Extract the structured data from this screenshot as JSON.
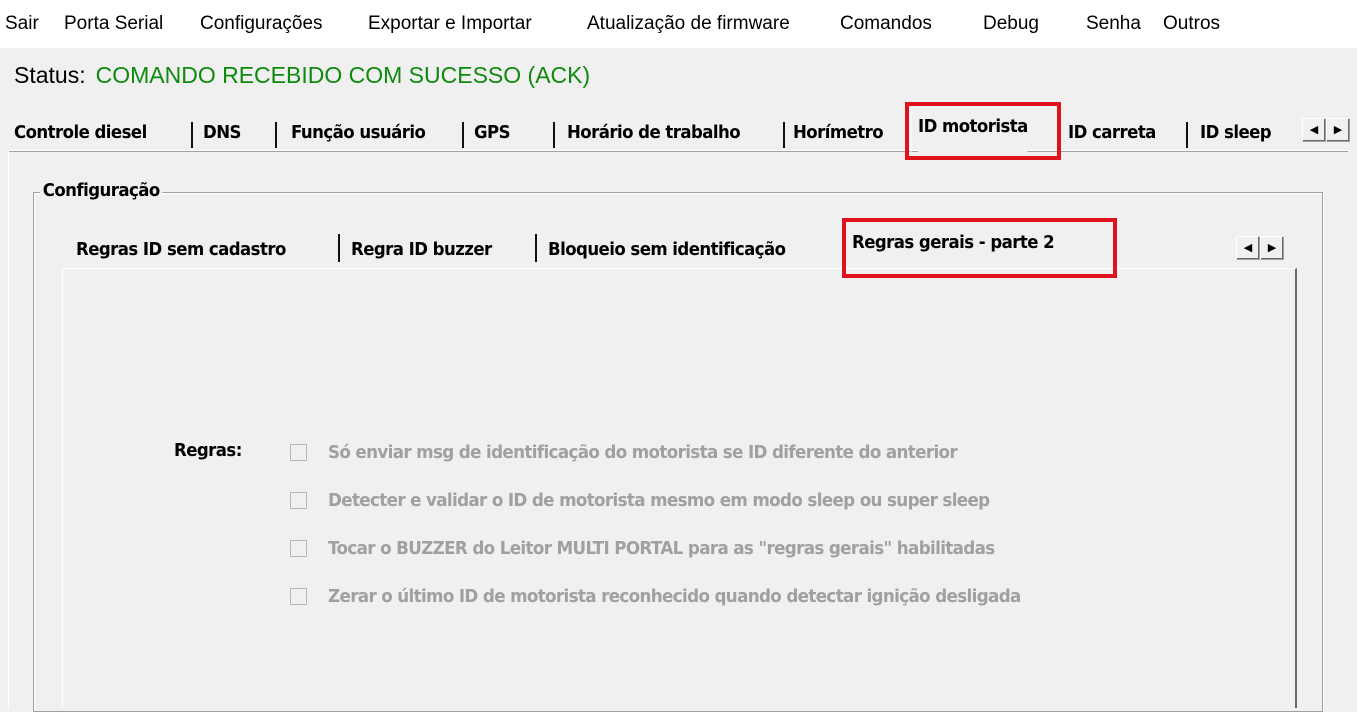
{
  "menu": {
    "items": [
      "Sair",
      "Porta Serial",
      "Configurações",
      "Exportar e Importar",
      "Atualização de firmware",
      "Comandos",
      "Debug",
      "Senha",
      "Outros"
    ]
  },
  "status": {
    "label": "Status:",
    "value": "COMANDO RECEBIDO COM SUCESSO (ACK)",
    "value_color": "#0e8a0e"
  },
  "outer_tabs": {
    "items": [
      "Controle diesel",
      "DNS",
      "Função usuário",
      "GPS",
      "Horário de trabalho",
      "Horímetro",
      "ID motorista",
      "ID carreta",
      "ID sleep"
    ],
    "active": "ID motorista"
  },
  "group": {
    "title": "Configuração"
  },
  "inner_tabs": {
    "items": [
      "Regras ID sem cadastro",
      "Regra ID buzzer",
      "Bloqueio sem identificação",
      "Regras gerais - parte 2"
    ],
    "active": "Regras gerais - parte 2"
  },
  "rules": {
    "label": "Regras:",
    "items": [
      {
        "text": "Só enviar msg de identificação do motorista se ID diferente do anterior",
        "checked": false,
        "enabled": false
      },
      {
        "text": "Detecter e validar o ID de motorista mesmo em modo sleep ou super sleep",
        "checked": false,
        "enabled": false
      },
      {
        "text": "Tocar o BUZZER do Leitor MULTI PORTAL para as \"regras gerais\" habilitadas",
        "checked": false,
        "enabled": false
      },
      {
        "text": "Zerar o último ID de motorista reconhecido quando detectar ignição desligada",
        "checked": false,
        "enabled": false
      }
    ]
  },
  "highlight_color": "#e0121c",
  "scroll_icons": [
    "left-arrow-icon",
    "right-arrow-icon"
  ]
}
